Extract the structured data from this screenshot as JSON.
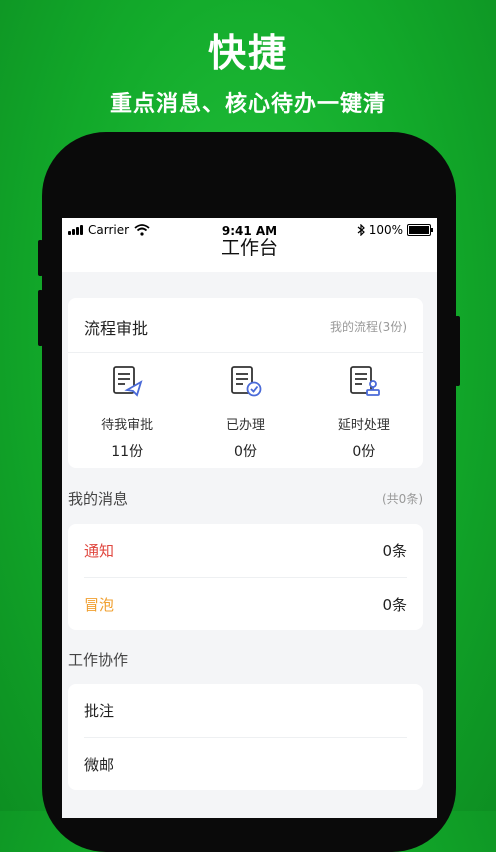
{
  "promo": {
    "headline": "快捷",
    "subline": "重点消息、核心待办一键清"
  },
  "statusbar": {
    "carrier": "Carrier",
    "time": "9:41 AM",
    "battery": "100%"
  },
  "navbar": {
    "title": "工作台"
  },
  "flow": {
    "title": "流程审批",
    "my_flow": "我的流程(3份)",
    "items": [
      {
        "label": "待我审批",
        "count": "11份",
        "icon": "approve-send-icon"
      },
      {
        "label": "已办理",
        "count": "0份",
        "icon": "done-check-icon"
      },
      {
        "label": "延时处理",
        "count": "0份",
        "icon": "delay-stamp-icon"
      }
    ]
  },
  "messages": {
    "title": "我的消息",
    "total": "(共0条)",
    "items": [
      {
        "label": "通知",
        "value": "0条",
        "color": "#e0473f"
      },
      {
        "label": "冒泡",
        "value": "0条",
        "color": "#f0a030"
      }
    ]
  },
  "collab": {
    "title": "工作协作",
    "items": [
      {
        "label": "批注"
      },
      {
        "label": "微邮"
      }
    ]
  },
  "colors": {
    "brand_green": "#1db635",
    "icon_blue": "#4a6ad8"
  }
}
